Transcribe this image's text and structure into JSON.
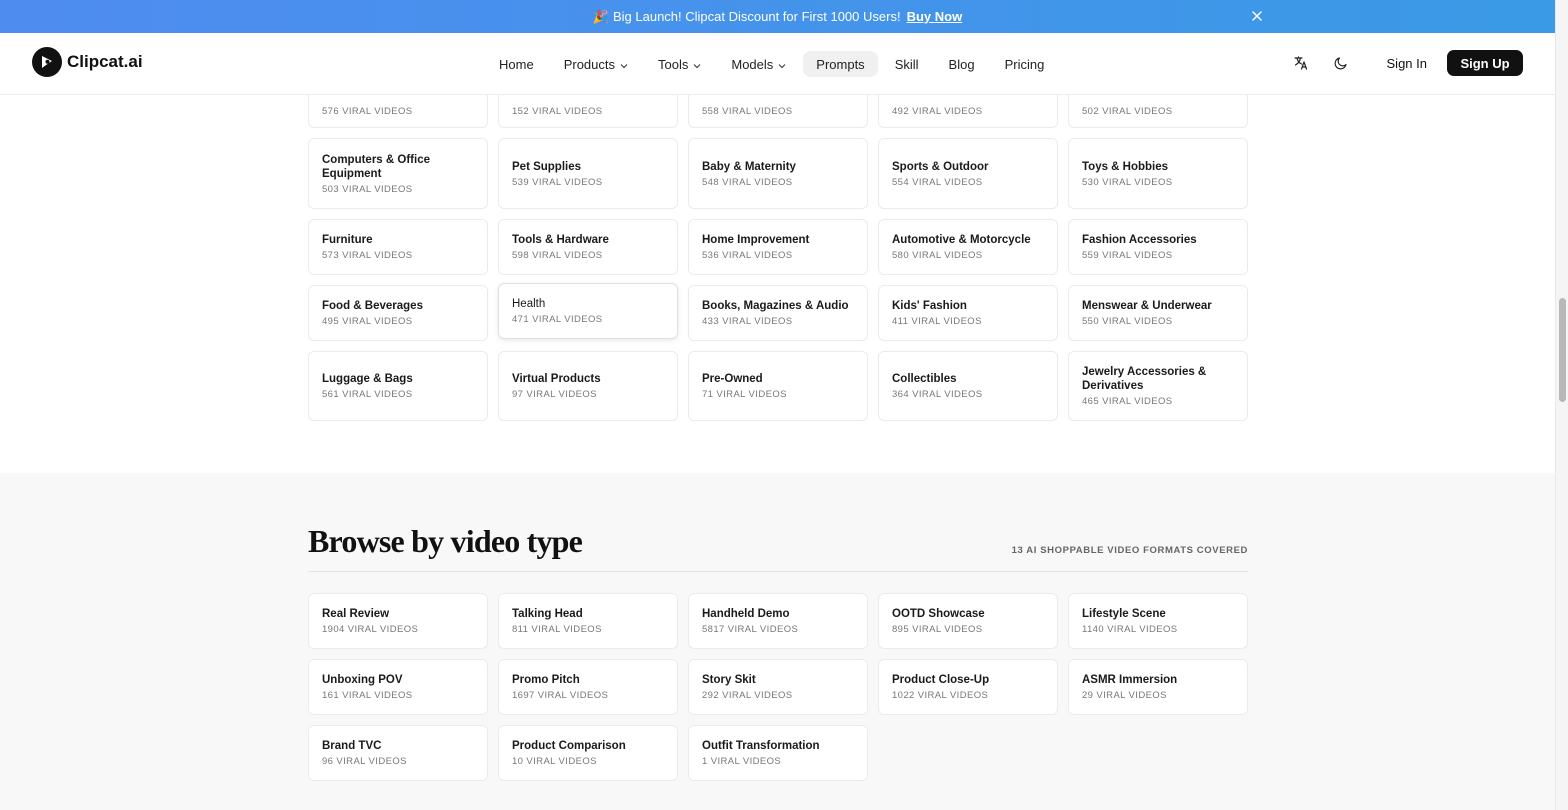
{
  "announcement": {
    "emoji": "🎉",
    "text": "Big Launch! Clipcat Discount for First 1000 Users!",
    "cta": "Buy Now"
  },
  "nav": {
    "brand": "Clipcat.ai",
    "menu": [
      {
        "label": "Home",
        "dropdown": false
      },
      {
        "label": "Products",
        "dropdown": true
      },
      {
        "label": "Tools",
        "dropdown": true
      },
      {
        "label": "Models",
        "dropdown": true
      },
      {
        "label": "Prompts",
        "dropdown": false,
        "active": true
      },
      {
        "label": "Skill",
        "dropdown": false
      },
      {
        "label": "Blog",
        "dropdown": false
      },
      {
        "label": "Pricing",
        "dropdown": false
      }
    ],
    "sign_in": "Sign In",
    "sign_up": "Sign Up"
  },
  "categories": {
    "rows": [
      [
        {
          "name": "",
          "count": "576 VIRAL VIDEOS"
        },
        {
          "name": "",
          "count": "152 VIRAL VIDEOS"
        },
        {
          "name": "",
          "count": "558 VIRAL VIDEOS"
        },
        {
          "name": "",
          "count": "492 VIRAL VIDEOS"
        },
        {
          "name": "",
          "count": "502 VIRAL VIDEOS"
        }
      ],
      [
        {
          "name": "Computers & Office Equipment",
          "count": "503 VIRAL VIDEOS"
        },
        {
          "name": "Pet Supplies",
          "count": "539 VIRAL VIDEOS"
        },
        {
          "name": "Baby & Maternity",
          "count": "548 VIRAL VIDEOS"
        },
        {
          "name": "Sports & Outdoor",
          "count": "554 VIRAL VIDEOS"
        },
        {
          "name": "Toys & Hobbies",
          "count": "530 VIRAL VIDEOS"
        }
      ],
      [
        {
          "name": "Furniture",
          "count": "573 VIRAL VIDEOS"
        },
        {
          "name": "Tools & Hardware",
          "count": "598 VIRAL VIDEOS"
        },
        {
          "name": "Home Improvement",
          "count": "536 VIRAL VIDEOS"
        },
        {
          "name": "Automotive & Motorcycle",
          "count": "580 VIRAL VIDEOS"
        },
        {
          "name": "Fashion Accessories",
          "count": "559 VIRAL VIDEOS"
        }
      ],
      [
        {
          "name": "Food & Beverages",
          "count": "495 VIRAL VIDEOS"
        },
        {
          "name": "Health",
          "count": "471 VIRAL VIDEOS"
        },
        {
          "name": "Books, Magazines & Audio",
          "count": "433 VIRAL VIDEOS"
        },
        {
          "name": "Kids' Fashion",
          "count": "411 VIRAL VIDEOS"
        },
        {
          "name": "Menswear & Underwear",
          "count": "550 VIRAL VIDEOS"
        }
      ],
      [
        {
          "name": "Luggage & Bags",
          "count": "561 VIRAL VIDEOS"
        },
        {
          "name": "Virtual Products",
          "count": "97 VIRAL VIDEOS"
        },
        {
          "name": "Pre-Owned",
          "count": "71 VIRAL VIDEOS"
        },
        {
          "name": "Collectibles",
          "count": "364 VIRAL VIDEOS"
        },
        {
          "name": "Jewelry Accessories & Derivatives",
          "count": "465 VIRAL VIDEOS"
        }
      ]
    ]
  },
  "browse": {
    "title": "Browse by video type",
    "subtitle": "13 AI SHOPPABLE VIDEO FORMATS COVERED",
    "types": [
      {
        "name": "Real Review",
        "count": "1904 VIRAL VIDEOS"
      },
      {
        "name": "Talking Head",
        "count": "811 VIRAL VIDEOS"
      },
      {
        "name": "Handheld Demo",
        "count": "5817 VIRAL VIDEOS"
      },
      {
        "name": "OOTD Showcase",
        "count": "895 VIRAL VIDEOS"
      },
      {
        "name": "Lifestyle Scene",
        "count": "1140 VIRAL VIDEOS"
      },
      {
        "name": "Unboxing POV",
        "count": "161 VIRAL VIDEOS"
      },
      {
        "name": "Promo Pitch",
        "count": "1697 VIRAL VIDEOS"
      },
      {
        "name": "Story Skit",
        "count": "292 VIRAL VIDEOS"
      },
      {
        "name": "Product Close-Up",
        "count": "1022 VIRAL VIDEOS"
      },
      {
        "name": "ASMR Immersion",
        "count": "29 VIRAL VIDEOS"
      },
      {
        "name": "Brand TVC",
        "count": "96 VIRAL VIDEOS"
      },
      {
        "name": "Product Comparison",
        "count": "10 VIRAL VIDEOS"
      },
      {
        "name": "Outfit Transformation",
        "count": "1 VIRAL VIDEOS"
      }
    ]
  }
}
